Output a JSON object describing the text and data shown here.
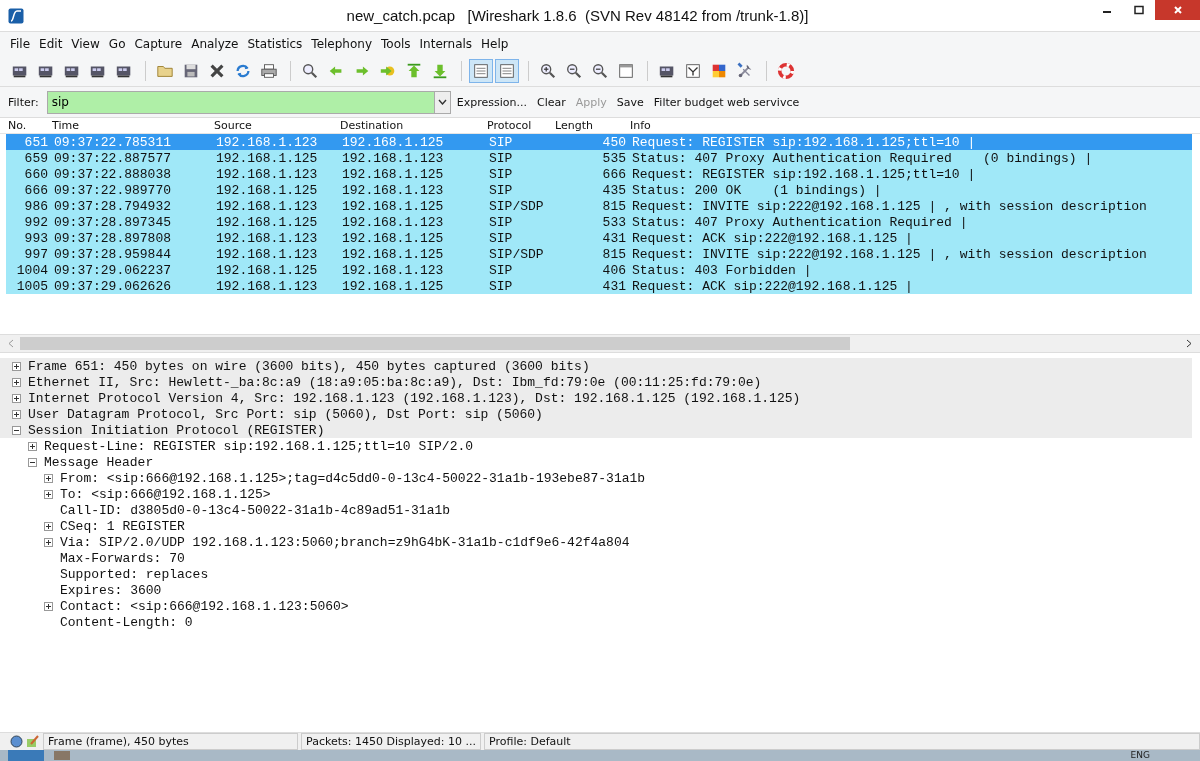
{
  "window": {
    "title": "new_catch.pcap   [Wireshark 1.8.6  (SVN Rev 48142 from /trunk-1.8)]"
  },
  "menu": [
    {
      "label": "File"
    },
    {
      "label": "Edit"
    },
    {
      "label": "View"
    },
    {
      "label": "Go"
    },
    {
      "label": "Capture"
    },
    {
      "label": "Analyze"
    },
    {
      "label": "Statistics"
    },
    {
      "label": "Telephony"
    },
    {
      "label": "Tools"
    },
    {
      "label": "Internals"
    },
    {
      "label": "Help"
    }
  ],
  "toolbar": [
    {
      "kind": "card",
      "selected": false
    },
    {
      "kind": "card",
      "selected": false
    },
    {
      "kind": "card",
      "selected": false
    },
    {
      "kind": "card",
      "selected": false
    },
    {
      "kind": "card",
      "selected": false
    },
    {
      "kind": "separator"
    },
    {
      "kind": "folder",
      "selected": false
    },
    {
      "kind": "save",
      "selected": false
    },
    {
      "kind": "close",
      "selected": false
    },
    {
      "kind": "reload",
      "selected": false
    },
    {
      "kind": "print",
      "selected": false
    },
    {
      "kind": "separator"
    },
    {
      "kind": "search",
      "selected": false
    },
    {
      "kind": "back",
      "selected": false
    },
    {
      "kind": "forward",
      "selected": false
    },
    {
      "kind": "goto",
      "selected": false
    },
    {
      "kind": "first",
      "selected": false
    },
    {
      "kind": "last",
      "selected": false
    },
    {
      "kind": "separator"
    },
    {
      "kind": "list",
      "selected": true
    },
    {
      "kind": "list",
      "selected": true
    },
    {
      "kind": "separator"
    },
    {
      "kind": "zoom-in",
      "selected": false
    },
    {
      "kind": "zoom-out",
      "selected": false
    },
    {
      "kind": "zoom-reset",
      "selected": false
    },
    {
      "kind": "columns",
      "selected": false
    },
    {
      "kind": "separator"
    },
    {
      "kind": "card",
      "selected": false
    },
    {
      "kind": "filter",
      "selected": false
    },
    {
      "kind": "colors",
      "selected": false
    },
    {
      "kind": "tools",
      "selected": false
    },
    {
      "kind": "separator"
    },
    {
      "kind": "lifebuoy",
      "selected": false
    }
  ],
  "filter": {
    "label": "Filter:",
    "value": "sip",
    "actions": [
      {
        "label": "Expression...",
        "disabled": false
      },
      {
        "label": "Clear",
        "disabled": false
      },
      {
        "label": "Apply",
        "disabled": true
      },
      {
        "label": "Save",
        "disabled": false
      },
      {
        "label": "Filter budget web servivce",
        "disabled": false
      }
    ]
  },
  "packets": {
    "columns": [
      "No.",
      "Time",
      "Source",
      "Destination",
      "Protocol",
      "Length",
      "Info"
    ],
    "rows": [
      {
        "no": "651",
        "time": "09:37:22.785311",
        "source": "192.168.1.123",
        "destination": "192.168.1.125",
        "protocol": "SIP",
        "length": "450",
        "info": "Request: REGISTER sip:192.168.1.125;ttl=10 |",
        "selected": true
      },
      {
        "no": "659",
        "time": "09:37:22.887577",
        "source": "192.168.1.125",
        "destination": "192.168.1.123",
        "protocol": "SIP",
        "length": "535",
        "info": "Status: 407 Proxy Authentication Required    (0 bindings) |",
        "selected": false
      },
      {
        "no": "660",
        "time": "09:37:22.888038",
        "source": "192.168.1.123",
        "destination": "192.168.1.125",
        "protocol": "SIP",
        "length": "666",
        "info": "Request: REGISTER sip:192.168.1.125;ttl=10 |",
        "selected": false
      },
      {
        "no": "666",
        "time": "09:37:22.989770",
        "source": "192.168.1.125",
        "destination": "192.168.1.123",
        "protocol": "SIP",
        "length": "435",
        "info": "Status: 200 OK    (1 bindings) |",
        "selected": false
      },
      {
        "no": "986",
        "time": "09:37:28.794932",
        "source": "192.168.1.123",
        "destination": "192.168.1.125",
        "protocol": "SIP/SDP",
        "length": "815",
        "info": "Request: INVITE sip:222@192.168.1.125 | , with session description",
        "selected": false
      },
      {
        "no": "992",
        "time": "09:37:28.897345",
        "source": "192.168.1.125",
        "destination": "192.168.1.123",
        "protocol": "SIP",
        "length": "533",
        "info": "Status: 407 Proxy Authentication Required |",
        "selected": false
      },
      {
        "no": "993",
        "time": "09:37:28.897808",
        "source": "192.168.1.123",
        "destination": "192.168.1.125",
        "protocol": "SIP",
        "length": "431",
        "info": "Request: ACK sip:222@192.168.1.125 |",
        "selected": false
      },
      {
        "no": "997",
        "time": "09:37:28.959844",
        "source": "192.168.1.123",
        "destination": "192.168.1.125",
        "protocol": "SIP/SDP",
        "length": "815",
        "info": "Request: INVITE sip:222@192.168.1.125 | , with session description",
        "selected": false
      },
      {
        "no": "1004",
        "time": "09:37:29.062237",
        "source": "192.168.1.125",
        "destination": "192.168.1.123",
        "protocol": "SIP",
        "length": "406",
        "info": "Status: 403 Forbidden |",
        "selected": false
      },
      {
        "no": "1005",
        "time": "09:37:29.062626",
        "source": "192.168.1.123",
        "destination": "192.168.1.125",
        "protocol": "SIP",
        "length": "431",
        "info": "Request: ACK sip:222@192.168.1.125 |",
        "selected": false
      }
    ]
  },
  "details": [
    {
      "text": "Frame 651: 450 bytes on wire (3600 bits), 450 bytes captured (3600 bits)",
      "expanded": false
    },
    {
      "text": "Ethernet II, Src: Hewlett-_ba:8c:a9 (18:a9:05:ba:8c:a9), Dst: Ibm_fd:79:0e (00:11:25:fd:79:0e)",
      "expanded": false
    },
    {
      "text": "Internet Protocol Version 4, Src: 192.168.1.123 (192.168.1.123), Dst: 192.168.1.125 (192.168.1.125)",
      "expanded": false
    },
    {
      "text": "User Datagram Protocol, Src Port: sip (5060), Dst Port: sip (5060)",
      "expanded": false
    },
    {
      "text": "Session Initiation Protocol (REGISTER)",
      "expanded": true,
      "children": [
        {
          "text": "Request-Line: REGISTER sip:192.168.1.125;ttl=10 SIP/2.0",
          "expanded": false
        },
        {
          "text": "Message Header",
          "expanded": true,
          "children": [
            {
              "text": "From: <sip:666@192.168.1.125>;tag=d4c5dd0-0-13c4-50022-31a1b-193ebe87-31a1b",
              "expanded": false
            },
            {
              "text": "To: <sip:666@192.168.1.125>",
              "expanded": false
            },
            {
              "text": "Call-ID: d3805d0-0-13c4-50022-31a1b-4c89ad51-31a1b"
            },
            {
              "text": "CSeq: 1 REGISTER",
              "expanded": false
            },
            {
              "text": "Via: SIP/2.0/UDP 192.168.1.123:5060;branch=z9hG4bK-31a1b-c1df9e6-42f4a804",
              "expanded": false
            },
            {
              "text": "Max-Forwards: 70"
            },
            {
              "text": "Supported: replaces"
            },
            {
              "text": "Expires: 3600"
            },
            {
              "text": "Contact: <sip:666@192.168.1.123:5060>",
              "expanded": false
            },
            {
              "text": "Content-Length: 0"
            }
          ]
        }
      ]
    }
  ],
  "status_bar": {
    "frame": "Frame (frame), 450 bytes",
    "packets": "Packets: 1450 Displayed: 10 ...",
    "profile": "Profile: Default"
  },
  "taskbar": {
    "language": "ENG"
  }
}
